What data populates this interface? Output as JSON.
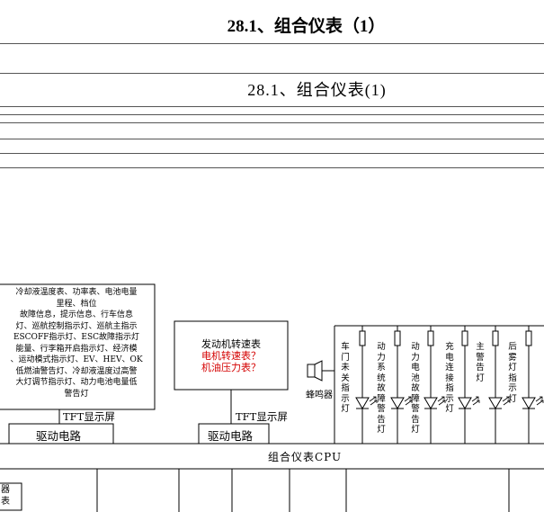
{
  "page_title": "28.1、组合仪表（1）",
  "frame_title": "28.1、组合仪表(1)",
  "tft_box_left": {
    "lines": [
      "冷却液温度表、功率表、电池电量",
      "里程、档位",
      "故障信息，提示信息、行车信息",
      "灯、巡航控制指示灯、巡航主指示",
      "ESCOFF指示灯、ESC故障指示灯",
      "能量、行李箱开启指示灯、经济模",
      "、运动模式指示灯、EV、HEV、OK",
      "低燃油警告灯、冷却液温度过高警",
      "大灯调节指示灯、动力电池电量低",
      "警告灯"
    ],
    "screen_label": "TFT显示屏",
    "driver_label": "驱动电路"
  },
  "tft_box_right": {
    "line1": "发动机转速表",
    "line2": "电机转速表？",
    "line3": "机油压力表？",
    "screen_label": "TFT显示屏",
    "driver_label": "驱动电路"
  },
  "buzzer_label": "蜂鸣器",
  "indicators": [
    "车门未关指示灯",
    "动力系统故障警告灯",
    "动力电池故障警告灯",
    "充电连接指示灯",
    "主警告灯",
    "后雾灯指示灯"
  ],
  "cpu_label": "组合仪表CPU",
  "bottom_left_label": "器\n表"
}
